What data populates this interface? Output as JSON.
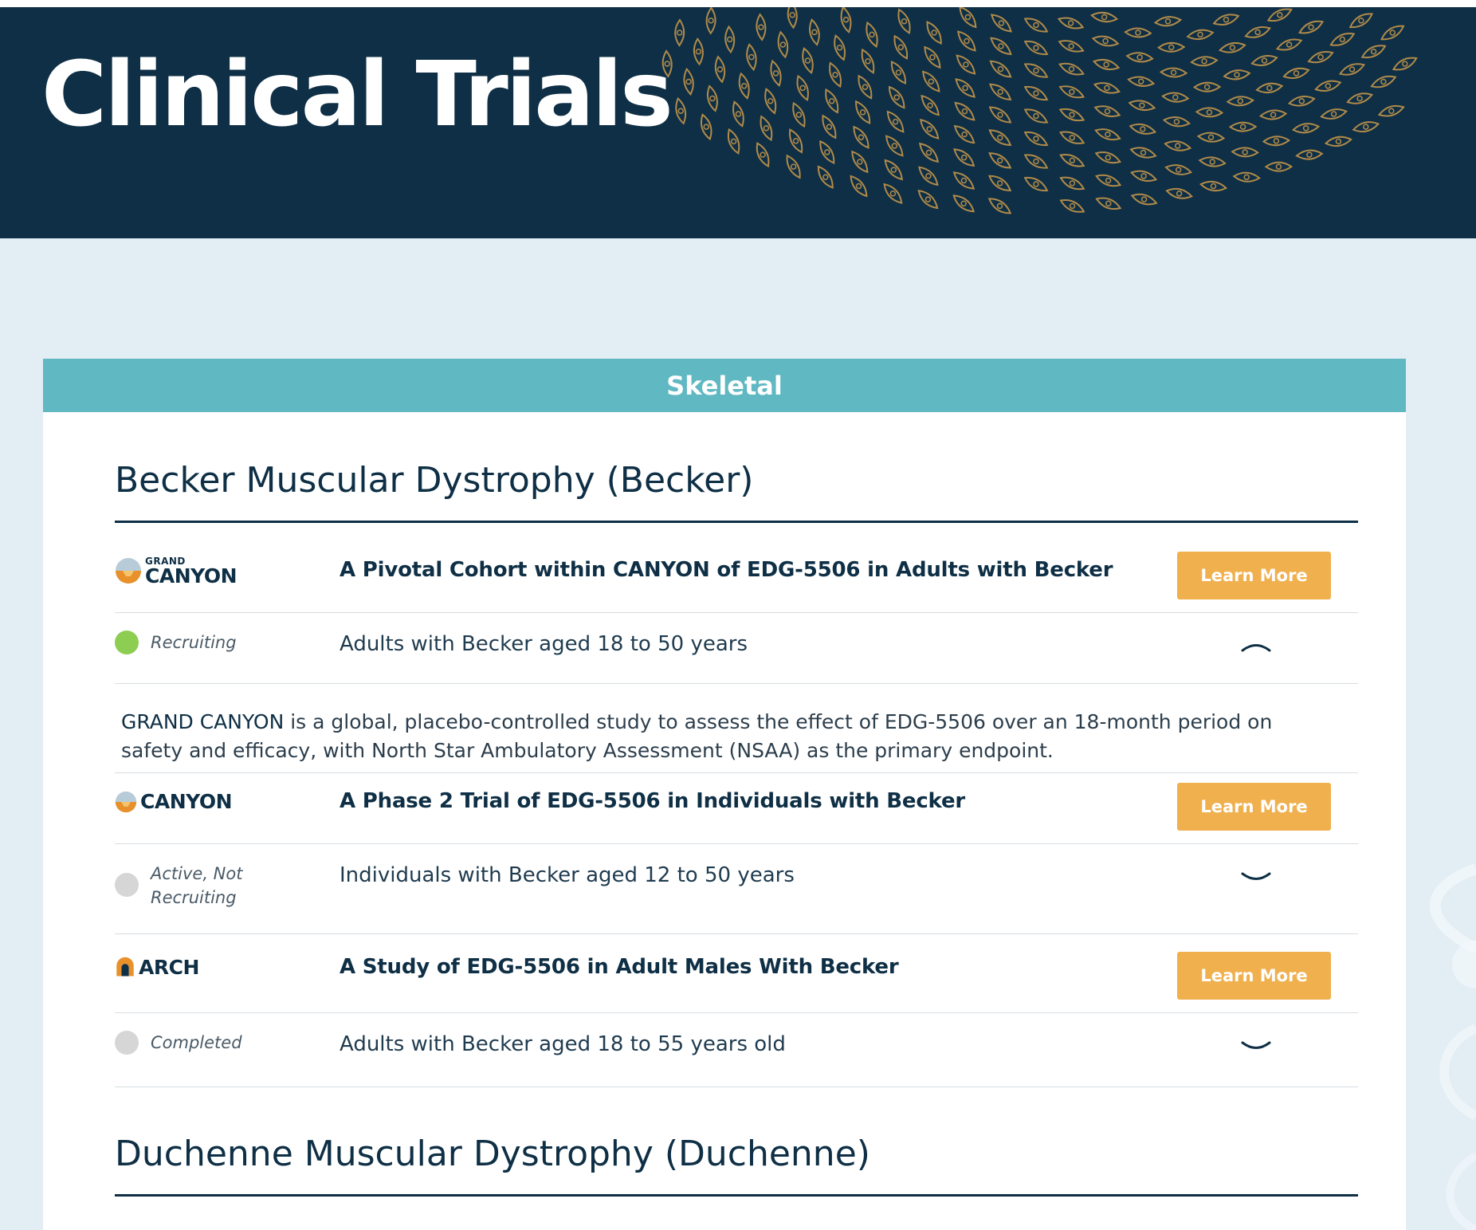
{
  "hero": {
    "title": "Clinical Trials",
    "background_color": "#0e2f45",
    "pattern_color": "#b08a4a"
  },
  "category": {
    "label": "Skeletal",
    "color": "#5fb8c2"
  },
  "sections": [
    {
      "title": "Becker Muscular Dystrophy (Becker)",
      "trials": [
        {
          "logo_small": "GRAND",
          "logo_big": "CANYON",
          "logo_icon": "canyon-sun-icon",
          "title": "A Pivotal Cohort within CANYON of EDG-5506 in Adults with Becker",
          "button": "Learn More",
          "status": "Recruiting",
          "status_color": "#8ccd52",
          "population": "Adults with Becker aged 18 to 50 years",
          "expanded": true,
          "description_lead": "GRAND CANYON",
          "description_rest": " is a global, placebo-controlled study to assess the effect of EDG-5506 over an 18-month period on safety and efficacy, with North Star Ambulatory Assessment (NSAA) as the primary endpoint."
        },
        {
          "logo_big": "CANYON",
          "logo_icon": "canyon-sun-icon",
          "title": "A Phase 2 Trial of EDG-5506 in Individuals with Becker",
          "button": "Learn More",
          "status": "Active, Not Recruiting",
          "status_color": "#d6d6d6",
          "population": "Individuals with Becker aged 12 to 50 years",
          "expanded": false
        },
        {
          "logo_big": "ARCH",
          "logo_icon": "arch-icon",
          "title": "A Study of EDG-5506 in Adult Males With Becker",
          "button": "Learn More",
          "status": "Completed",
          "status_color": "#d6d6d6",
          "population": "Adults with Becker aged 18 to 55 years old",
          "expanded": false
        }
      ]
    },
    {
      "title": "Duchenne Muscular Dystrophy (Duchenne)"
    }
  ],
  "colors": {
    "page_background": "#e2edf4",
    "button": "#f0b04e",
    "navy": "#0e2f45"
  }
}
